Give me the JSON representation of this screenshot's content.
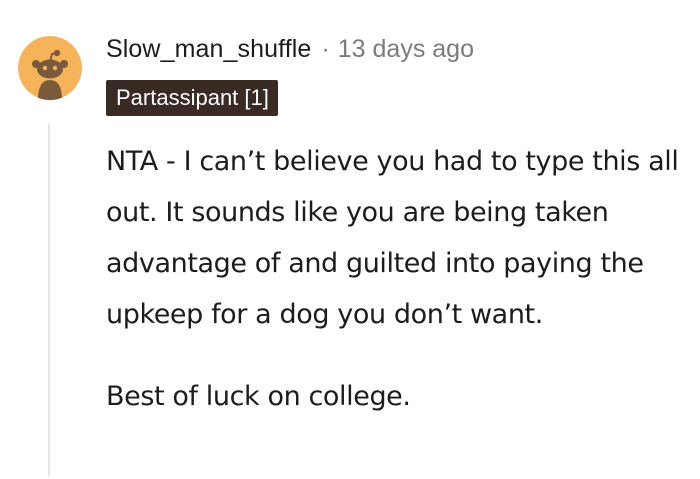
{
  "comment": {
    "username": "Slow_man_shuffle",
    "separator": "·",
    "timestamp": "13 days ago",
    "flair": "Partassipant [1]",
    "paragraphs": [
      "NTA - I can’t believe you had to type this all out. It sounds like you are being taken advantage of and guilted into paying the upkeep for a dog you don’t want.",
      "Best of luck on college."
    ],
    "avatar": {
      "icon": "reddit-snoo-avatar-icon",
      "background_color": "#f5b35a",
      "figure_color": "#7a5a3a"
    }
  }
}
